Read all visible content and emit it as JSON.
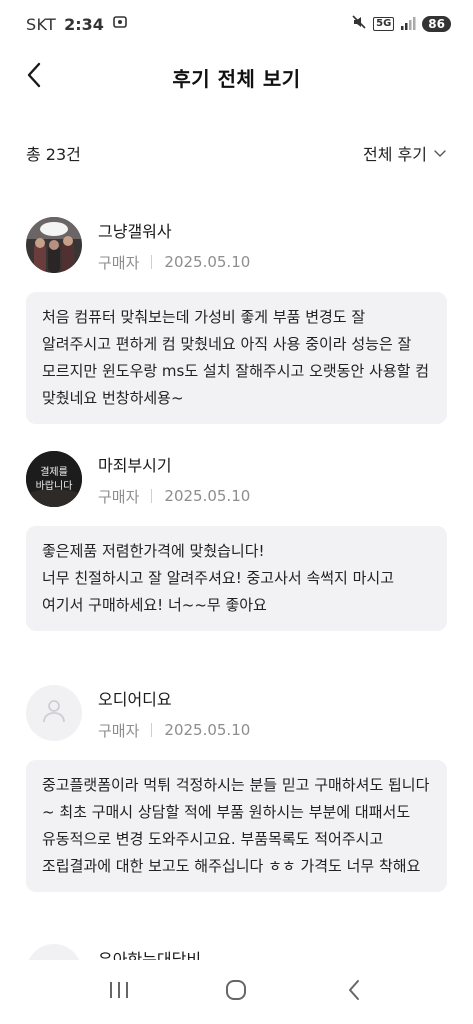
{
  "status_bar": {
    "carrier": "SKT",
    "time": "2:34",
    "network": "5G",
    "battery": "86"
  },
  "header": {
    "title": "후기 전체 보기",
    "back_icon": "chevron-left-icon"
  },
  "summary": {
    "total_label": "총 23건",
    "sort_label": "전체 후기",
    "sort_icon": "chevron-down-icon"
  },
  "reviews": [
    {
      "name": "그냥갤워사",
      "role": "구매자",
      "date": "2025.05.10",
      "lines": [
        "처음 컴퓨터 맞춰보는데 가성비 좋게 부품 변경도 잘 알려주시고 편하게 컴 맞췄네요 아직 사용 중이라 성능은 잘 모르지만 윈도우랑 ms도 설치 잘해주시고 오랫동안 사용할 컴 맞췄네요 번창하세용~"
      ]
    },
    {
      "name": "마죄부시기",
      "role": "구매자",
      "date": "2025.05.10",
      "avatar_text": "결제를 바랍니다",
      "lines": [
        "좋은제품 저렴한가격에 맞췄습니다!",
        "너무 친절하시고 잘 알려주셔요! 중고사서 속썩지 마시고",
        "여기서 구매하세요! 너~~무 좋아요"
      ]
    },
    {
      "name": "오디어디요",
      "role": "구매자",
      "date": "2025.05.10",
      "lines": [
        "중고플랫폼이라 먹튀 걱정하시는 분들 믿고 구매하셔도 됩니다~ 최초 구매시 상담할 적에 부품 원하시는 부분에 대패서도 유동적으로 변경 도와주시고요. 부품목록도 적어주시고 조립결과에 대한 보고도 해주십니다 ㅎㅎ 가격도 너무 착해요"
      ]
    },
    {
      "name": "우아한는대닥비"
    }
  ],
  "nav": {
    "recent_icon": "recent-apps-icon",
    "home_icon": "home-icon",
    "back_icon": "back-icon"
  }
}
